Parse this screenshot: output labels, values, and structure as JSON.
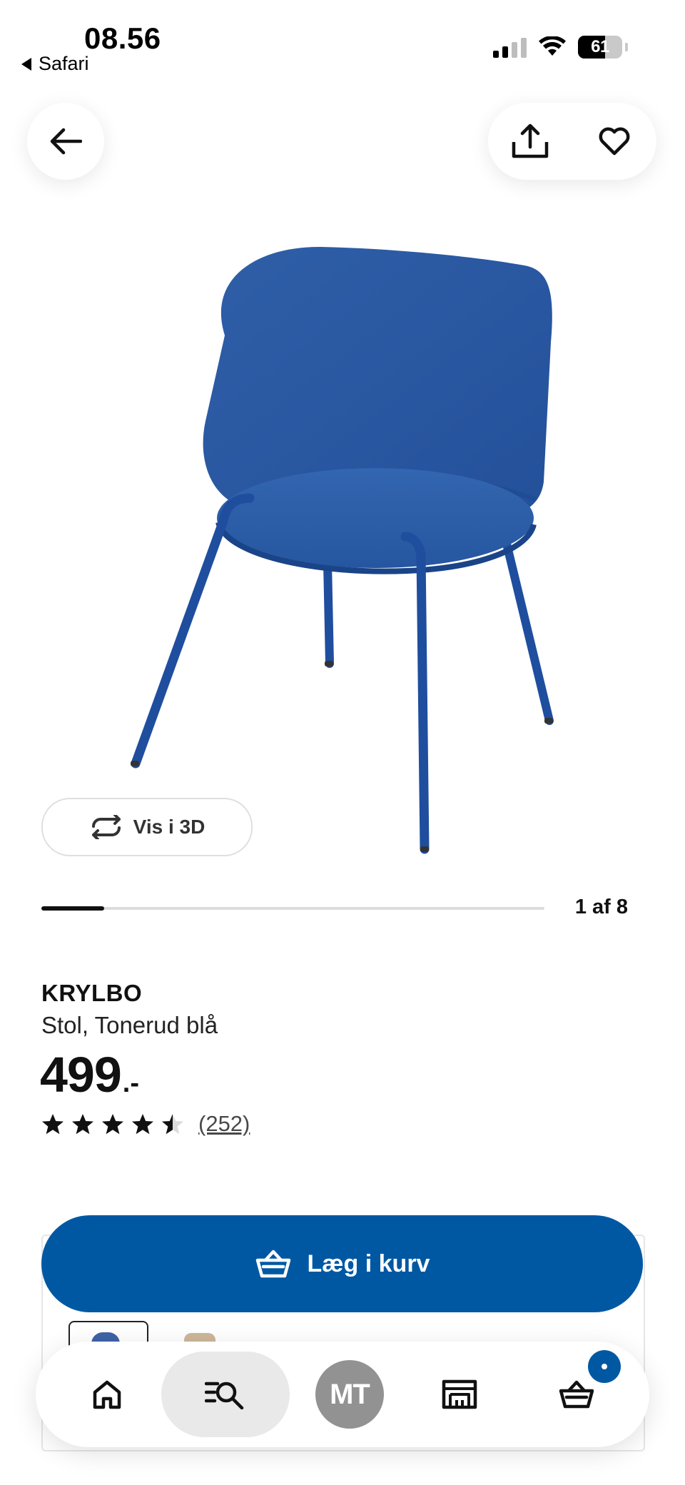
{
  "status_bar": {
    "time": "08.56",
    "back_app": "Safari",
    "battery": "61"
  },
  "header": {
    "back_icon": "arrow-left-icon",
    "share_icon": "share-icon",
    "favorite_icon": "heart-icon"
  },
  "gallery": {
    "view_3d_label": "Vis i 3D",
    "position_label": "1 af 8",
    "progress_fraction": 0.125
  },
  "product": {
    "name": "KRYLBO",
    "description": "Stol, Tonerud blå",
    "price": "499",
    "price_suffix": ".-",
    "rating": 4.5,
    "review_count": "(252)"
  },
  "actions": {
    "add_to_cart_label": "Læg i kurv"
  },
  "bottom_nav": {
    "items": [
      {
        "icon": "home-icon"
      },
      {
        "icon": "search-list-icon"
      },
      {
        "icon": "profile-avatar",
        "initials": "MT"
      },
      {
        "icon": "store-icon"
      },
      {
        "icon": "cart-icon"
      }
    ]
  },
  "colors": {
    "accent": "#0058a3",
    "chair": "#2a5ca8"
  }
}
